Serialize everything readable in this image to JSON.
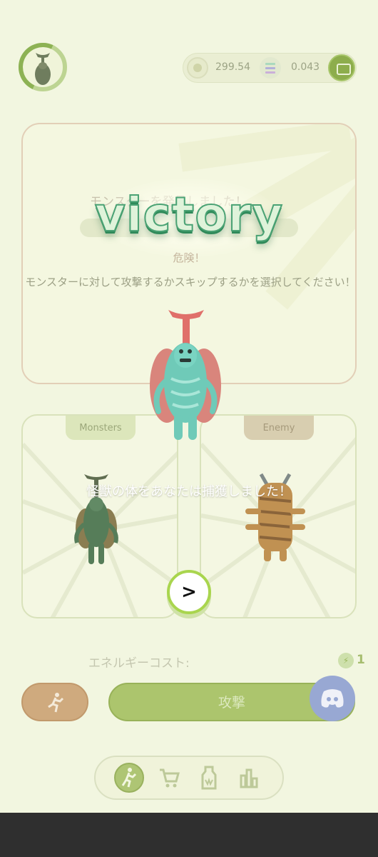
{
  "header": {
    "coin_balance": "299.54",
    "sol_balance": "0.043",
    "icons": {
      "coin": "coin-icon",
      "sol": "solana-icon",
      "wallet": "wallet-icon"
    }
  },
  "encounter": {
    "found_text": "モンスターを発見しました！",
    "danger_label": "危険！",
    "instruction": "モンスターに対して攻撃するかスキップするかを選択してください！"
  },
  "battle": {
    "monsters_tab": "Monsters",
    "enemy_tab": "Enemy"
  },
  "actions": {
    "energy_cost_label": "エネルギーコスト:",
    "energy_cost_value": "1",
    "attack_label": "攻撃"
  },
  "victory": {
    "title": "victory",
    "captured_message": "怪獣の体をあなたは捕獲しました！",
    "next_label": ">"
  },
  "nav": {
    "items": [
      "walk",
      "shop",
      "bottle",
      "stats"
    ]
  },
  "colors": {
    "accent_green": "#7ea236",
    "victory_green": "#4aa274",
    "skip_brown": "#c99f6f",
    "discord": "#8a9cd0"
  }
}
